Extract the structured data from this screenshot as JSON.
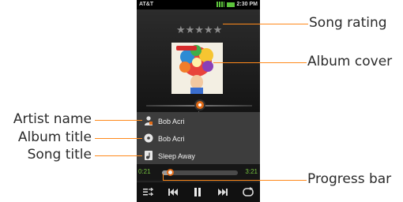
{
  "callouts": {
    "song_rating": "Song rating",
    "album_cover": "Album cover",
    "artist_name": "Artist name",
    "album_title": "Album title",
    "song_title": "Song title",
    "progress_bar": "Progress bar"
  },
  "status": {
    "carrier": "AT&T",
    "time": "2:30 PM"
  },
  "rating": {
    "stars": "★★★★★",
    "value": 0
  },
  "seek_value": "1",
  "rows": {
    "artist": "Bob Acri",
    "album": "Bob Acri",
    "song": "Sleep Away"
  },
  "progress": {
    "elapsed": "0:21",
    "total": "3:21",
    "fraction": 0.105
  },
  "controls": {
    "playlist_icon": "playlist-icon",
    "prev_icon": "previous-icon",
    "pause_icon": "pause-icon",
    "next_icon": "next-icon",
    "repeat_icon": "repeat-icon"
  },
  "colors": {
    "accent": "#ff8a1c",
    "progress_text": "#76c33f",
    "knob": "#e06a16"
  }
}
